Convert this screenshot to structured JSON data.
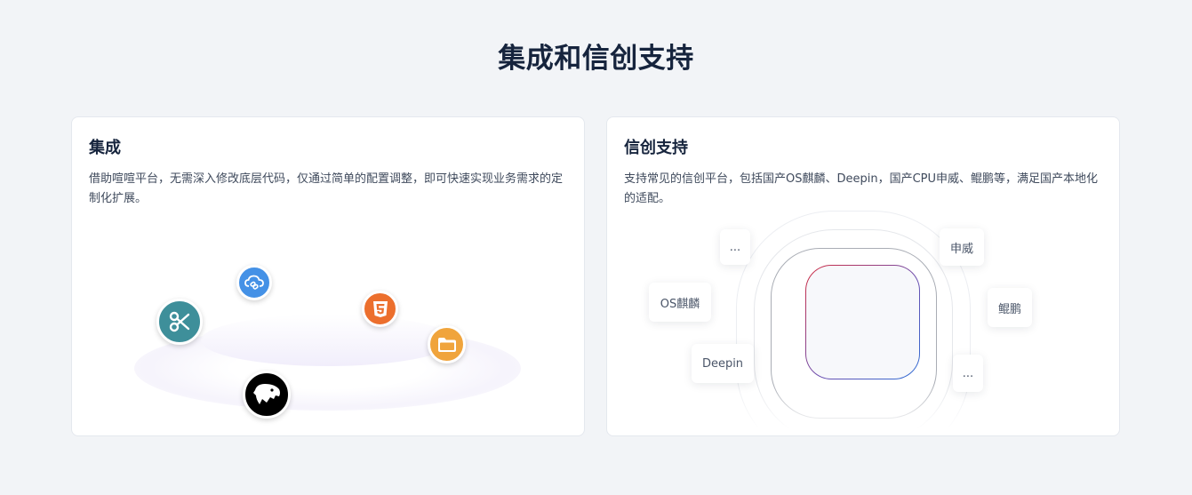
{
  "section": {
    "title": "集成和信创支持"
  },
  "integration": {
    "title": "集成",
    "description": "借助喧喧平台，无需深入修改底层代码，仅通过简单的配置调整，即可快速实现业务需求的定制化扩展。",
    "icons": [
      "scissors-icon",
      "cloud-link-icon",
      "html5-icon",
      "folder-icon",
      "animal-logo-icon"
    ]
  },
  "xinchuang": {
    "title": "信创支持",
    "description": "支持常见的信创平台，包括国产OS麒麟、Deepin，国产CPU申威、鲲鹏等，满足国产本地化的适配。",
    "tags": {
      "more_top": "...",
      "os_kylin": "OS麒麟",
      "deepin": "Deepin",
      "shenwei": "申威",
      "kunpeng": "鲲鹏",
      "more_bottom": "..."
    }
  },
  "colors": {
    "title": "#16243d",
    "scissors": "#3e8f9a",
    "cloud": "#4491e6",
    "html5": "#ec6f2d",
    "folder": "#f0a43c",
    "chip_gradient_start": "#d22a3f",
    "chip_gradient_end": "#2f6fd6"
  }
}
